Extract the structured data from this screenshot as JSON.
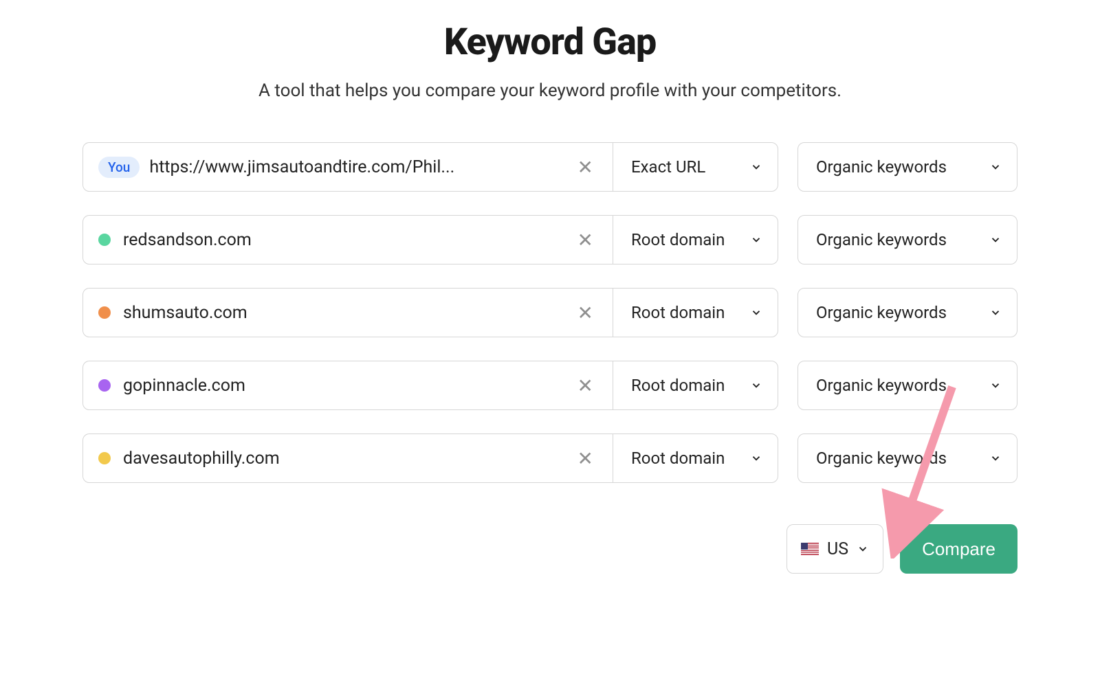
{
  "title": "Keyword Gap",
  "subtitle": "A tool that helps you compare your keyword profile with your competitors.",
  "you_badge": "You",
  "rows": [
    {
      "is_you": true,
      "value": "https://www.jimsautoandtire.com/Phil...",
      "match": "Exact URL",
      "kw": "Organic keywords",
      "color": ""
    },
    {
      "is_you": false,
      "value": "redsandson.com",
      "match": "Root domain",
      "kw": "Organic keywords",
      "color": "#5ad6a0"
    },
    {
      "is_you": false,
      "value": "shumsauto.com",
      "match": "Root domain",
      "kw": "Organic keywords",
      "color": "#f08f4b"
    },
    {
      "is_you": false,
      "value": "gopinnacle.com",
      "match": "Root domain",
      "kw": "Organic keywords",
      "color": "#a864f0"
    },
    {
      "is_you": false,
      "value": "davesautophilly.com",
      "match": "Root domain",
      "kw": "Organic keywords",
      "color": "#f2c94c"
    }
  ],
  "country": "US",
  "compare_label": "Compare"
}
